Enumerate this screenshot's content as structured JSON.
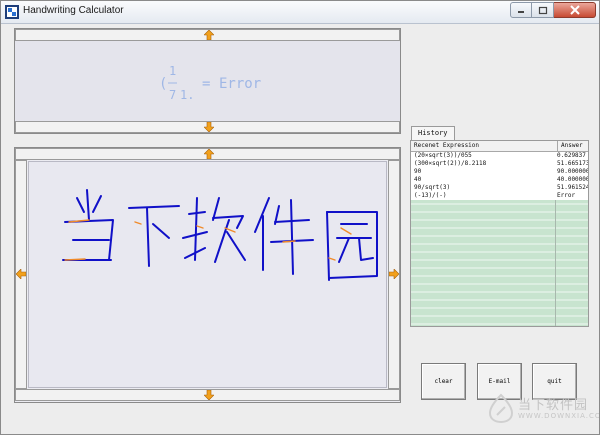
{
  "window": {
    "title": "Handwriting Calculator"
  },
  "result": {
    "open_paren": "(",
    "frac_num": "1",
    "frac_den": "7",
    "after": "1.",
    "equals": "=",
    "answer": "Error"
  },
  "history": {
    "tab_label": "History",
    "columns": [
      "Recenet Expression",
      "Answer"
    ],
    "rows": [
      {
        "expr": "(20×sqrt(3))/055",
        "answer": "0.629837"
      },
      {
        "expr": "(300×sqrt(2))/8.2118",
        "answer": "51.665173"
      },
      {
        "expr": "90",
        "answer": "90.000000"
      },
      {
        "expr": "40",
        "answer": "40.000000"
      },
      {
        "expr": "90/sqrt(3)",
        "answer": "51.961524"
      },
      {
        "expr": "(-13)/(-)",
        "answer": "Error"
      }
    ]
  },
  "buttons": {
    "clear": "clear",
    "email": "E-mail",
    "quit": "quit"
  },
  "watermark": {
    "text": "当下软件园",
    "url": "WWW.DOWNXIA.COM"
  },
  "colors": {
    "ink": "#1010c8",
    "accent": "#f08a2a",
    "result_text": "#9fb7e6",
    "grid": "#c8e4cf"
  }
}
